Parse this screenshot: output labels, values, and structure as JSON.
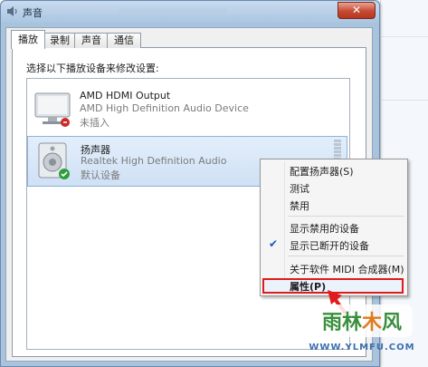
{
  "window": {
    "title": "声音"
  },
  "tabs": [
    {
      "label": "播放"
    },
    {
      "label": "录制"
    },
    {
      "label": "声音"
    },
    {
      "label": "通信"
    }
  ],
  "instruction": "选择以下播放设备来修改设置:",
  "devices": [
    {
      "name": "AMD HDMI Output",
      "description": "AMD High Definition Audio Device",
      "status": "未插入"
    },
    {
      "name": "扬声器",
      "description": "Realtek High Definition Audio",
      "status": "默认设备"
    }
  ],
  "context_menu": {
    "items": [
      {
        "label": "配置扬声器(S)"
      },
      {
        "label": "测试"
      },
      {
        "label": "禁用"
      },
      {
        "label": "显示禁用的设备"
      },
      {
        "label": "显示已断开的设备",
        "checked": true
      },
      {
        "label": "关于软件 MIDI 合成器(M)"
      },
      {
        "label": "属性(P)",
        "highlighted": true
      }
    ]
  },
  "watermark": {
    "name": "雨林木风",
    "url": "WWW.YLMFU.COM"
  },
  "colors": {
    "highlight_border": "#e01b1b",
    "arrow": "#e01b1b",
    "selection": "#cfe1f5"
  }
}
